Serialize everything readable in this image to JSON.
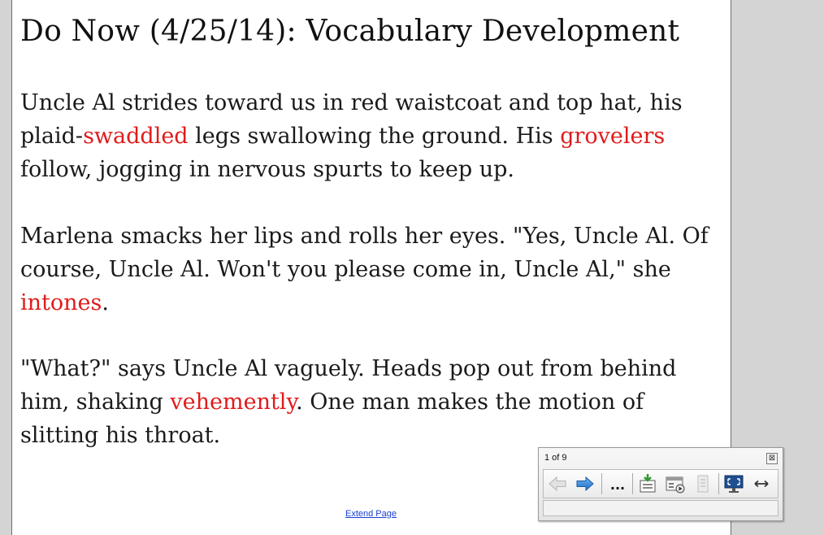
{
  "slide": {
    "title": "Do Now (4/25/14): Vocabulary Development",
    "p1": {
      "a": "Uncle Al strides toward us in red waistcoat and top hat, his plaid-",
      "v1": "swaddled",
      "b": " legs swallowing the ground.  His ",
      "v2": "grovelers",
      "c": " follow, jogging in nervous spurts to keep up."
    },
    "p2": {
      "a": "Marlena smacks her lips and rolls her eyes.  \"Yes, Uncle Al.  Of course, Uncle Al.  Won't you please come in, Uncle Al,\" she ",
      "v1": "intones",
      "b": "."
    },
    "p3": {
      "a": "\"What?\" says Uncle Al vaguely.  Heads pop out from behind him, shaking ",
      "v1": "vehemently",
      "b": ".  One man makes the motion of slitting his throat."
    },
    "vocab_color": "#e01b1b"
  },
  "extend_link": "Extend Page",
  "toolbar": {
    "page_count": "1 of 9",
    "close_glyph": "⊠",
    "more_glyph": "...",
    "buttons": [
      "back-arrow-icon",
      "forward-arrow-icon",
      "more-options-icon",
      "insert-page-icon",
      "media-player-icon",
      "delete-page-icon",
      "full-screen-icon",
      "move-toolbar-icon"
    ]
  }
}
